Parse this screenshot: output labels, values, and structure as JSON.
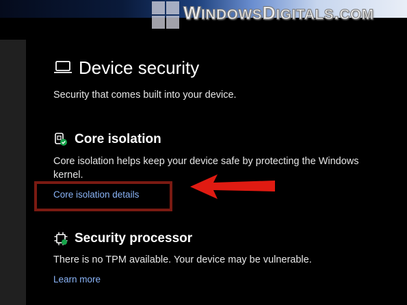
{
  "watermark": {
    "text": "WindowsDigitals.com",
    "icon": "windows-logo-icon"
  },
  "page": {
    "title": "Device security",
    "subtitle": "Security that comes built into your device.",
    "icon": "laptop-icon"
  },
  "core_isolation": {
    "title": "Core isolation",
    "description_line1": "Core isolation helps keep your device safe by protecting the Windows",
    "description_line2": "kernel.",
    "link": "Core isolation details",
    "icon": "core-isolation-icon"
  },
  "security_processor": {
    "title": "Security processor",
    "description": "There is no TPM available. Your device may be vulnerable.",
    "link": "Learn more",
    "icon": "chip-icon"
  },
  "annotation": {
    "arrow_color": "#e01b12",
    "box_color": "#7a1a12",
    "icon": "red-arrow-icon"
  }
}
